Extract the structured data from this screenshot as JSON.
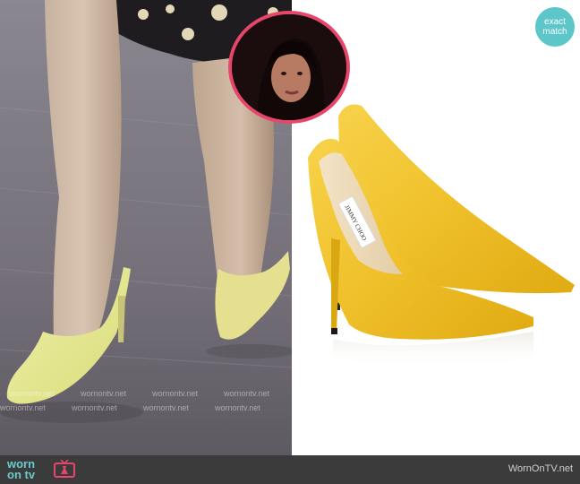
{
  "badge": {
    "line1": "exact",
    "line2": "match",
    "color": "#5cc6c9"
  },
  "watermark": {
    "text": "wornontv.net"
  },
  "footer": {
    "logo_top": "worn",
    "logo_bottom": "on tv",
    "site_name": "WornOnTV.net",
    "bg_color": "#3b3b3b",
    "logo_color": "#66ccd0"
  },
  "inset": {
    "border_color": "#e8456b"
  },
  "product": {
    "brand_label": "JIMMY CHOO",
    "shoe_color": "#f0c22e"
  }
}
